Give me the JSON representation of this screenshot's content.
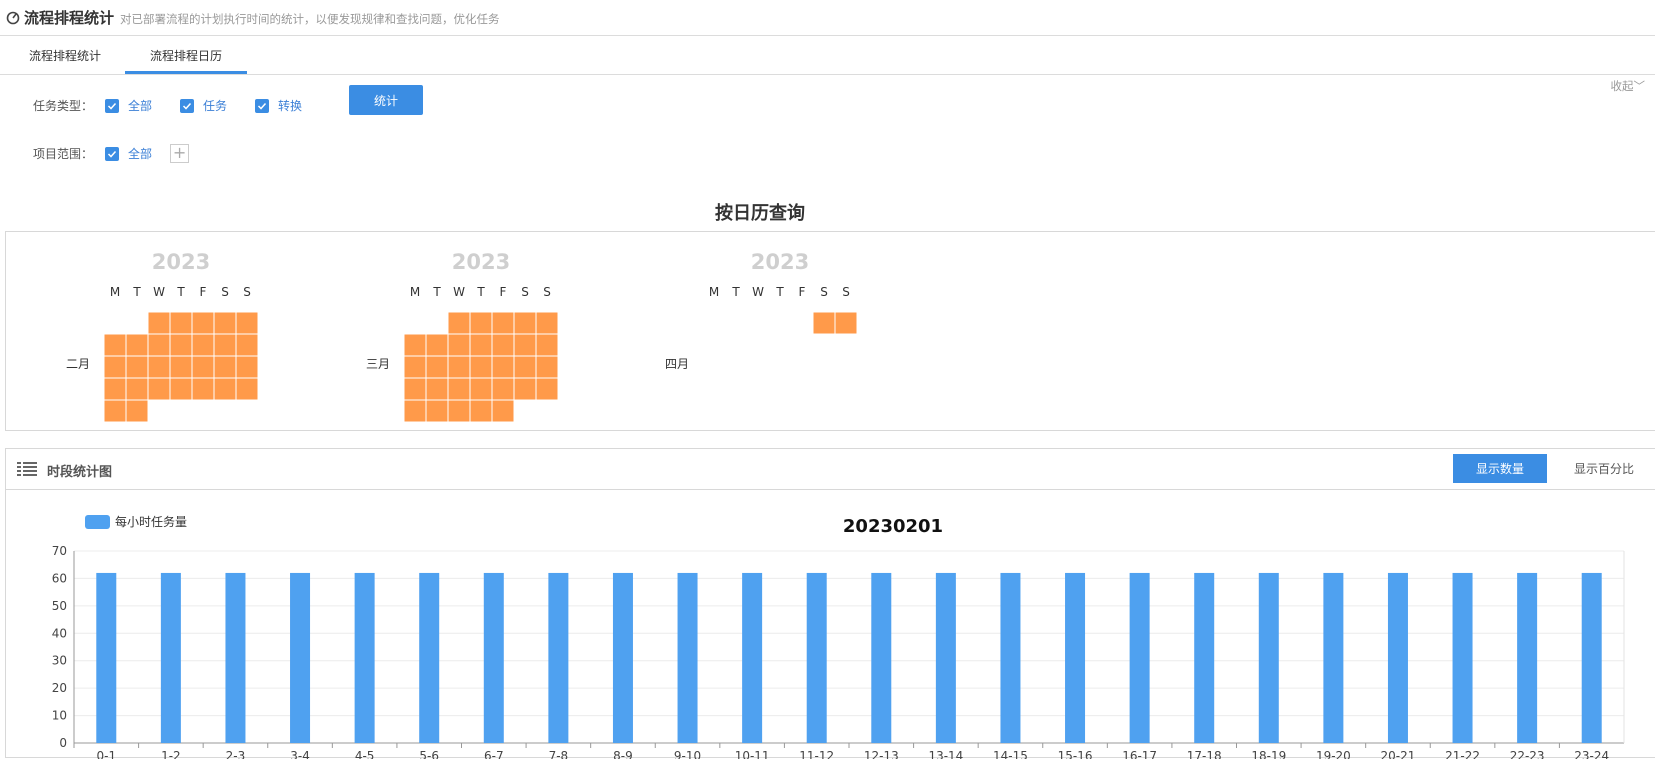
{
  "header": {
    "title": "流程排程统计",
    "description": "对已部署流程的计划执行时间的统计，以便发现规律和查找问题，优化任务"
  },
  "tabs": [
    {
      "label": "流程排程统计",
      "active": false
    },
    {
      "label": "流程排程日历",
      "active": true
    }
  ],
  "collapse_label": "收起",
  "filters": {
    "task_type": {
      "label": "任务类型：",
      "options": [
        {
          "label": "全部",
          "checked": true
        },
        {
          "label": "任务",
          "checked": true
        },
        {
          "label": "转换",
          "checked": true
        }
      ]
    },
    "project_scope": {
      "label": "项目范围：",
      "options": [
        {
          "label": "全部",
          "checked": true
        }
      ]
    },
    "submit_label": "统计"
  },
  "calendar": {
    "title": "按日历查询",
    "cell_color": "#ff9a4a",
    "months": [
      {
        "year": "2023",
        "label": "二月",
        "weekdays": [
          "M",
          "T",
          "W",
          "T",
          "F",
          "S",
          "S"
        ],
        "cells": [
          [
            0,
            2
          ],
          [
            0,
            3
          ],
          [
            0,
            4
          ],
          [
            0,
            5
          ],
          [
            0,
            6
          ],
          [
            1,
            0
          ],
          [
            1,
            1
          ],
          [
            1,
            2
          ],
          [
            1,
            3
          ],
          [
            1,
            4
          ],
          [
            1,
            5
          ],
          [
            1,
            6
          ],
          [
            2,
            0
          ],
          [
            2,
            1
          ],
          [
            2,
            2
          ],
          [
            2,
            3
          ],
          [
            2,
            4
          ],
          [
            2,
            5
          ],
          [
            2,
            6
          ],
          [
            3,
            0
          ],
          [
            3,
            1
          ],
          [
            3,
            2
          ],
          [
            3,
            3
          ],
          [
            3,
            4
          ],
          [
            3,
            5
          ],
          [
            3,
            6
          ],
          [
            4,
            0
          ],
          [
            4,
            1
          ]
        ]
      },
      {
        "year": "2023",
        "label": "三月",
        "weekdays": [
          "M",
          "T",
          "W",
          "T",
          "F",
          "S",
          "S"
        ],
        "cells": [
          [
            0,
            2
          ],
          [
            0,
            3
          ],
          [
            0,
            4
          ],
          [
            0,
            5
          ],
          [
            0,
            6
          ],
          [
            1,
            0
          ],
          [
            1,
            1
          ],
          [
            1,
            2
          ],
          [
            1,
            3
          ],
          [
            1,
            4
          ],
          [
            1,
            5
          ],
          [
            1,
            6
          ],
          [
            2,
            0
          ],
          [
            2,
            1
          ],
          [
            2,
            2
          ],
          [
            2,
            3
          ],
          [
            2,
            4
          ],
          [
            2,
            5
          ],
          [
            2,
            6
          ],
          [
            3,
            0
          ],
          [
            3,
            1
          ],
          [
            3,
            2
          ],
          [
            3,
            3
          ],
          [
            3,
            4
          ],
          [
            3,
            5
          ],
          [
            3,
            6
          ],
          [
            4,
            0
          ],
          [
            4,
            1
          ],
          [
            4,
            2
          ],
          [
            4,
            3
          ],
          [
            4,
            4
          ]
        ]
      },
      {
        "year": "2023",
        "label": "四月",
        "weekdays": [
          "M",
          "T",
          "W",
          "T",
          "F",
          "S",
          "S"
        ],
        "cells": [
          [
            0,
            5
          ],
          [
            0,
            6
          ]
        ]
      }
    ]
  },
  "stats": {
    "title": "时段统计图",
    "btn_count": "显示数量",
    "btn_percent": "显示百分比"
  },
  "chart_data": {
    "type": "bar",
    "title": "20230201",
    "legend": [
      "每小时任务量"
    ],
    "color": "#4fa1f0",
    "categories": [
      "0-1",
      "1-2",
      "2-3",
      "3-4",
      "4-5",
      "5-6",
      "6-7",
      "7-8",
      "8-9",
      "9-10",
      "10-11",
      "11-12",
      "12-13",
      "13-14",
      "14-15",
      "15-16",
      "16-17",
      "17-18",
      "18-19",
      "19-20",
      "20-21",
      "21-22",
      "22-23",
      "23-24"
    ],
    "series": [
      {
        "name": "每小时任务量",
        "values": [
          62,
          62,
          62,
          62,
          62,
          62,
          62,
          62,
          62,
          62,
          62,
          62,
          62,
          62,
          62,
          62,
          62,
          62,
          62,
          62,
          62,
          62,
          62,
          62
        ]
      }
    ],
    "yticks": [
      0,
      10,
      20,
      30,
      40,
      50,
      60,
      70
    ],
    "ylim": [
      0,
      70
    ],
    "xlabel": "",
    "ylabel": "",
    "grid": true,
    "legend_position": "top-left"
  }
}
